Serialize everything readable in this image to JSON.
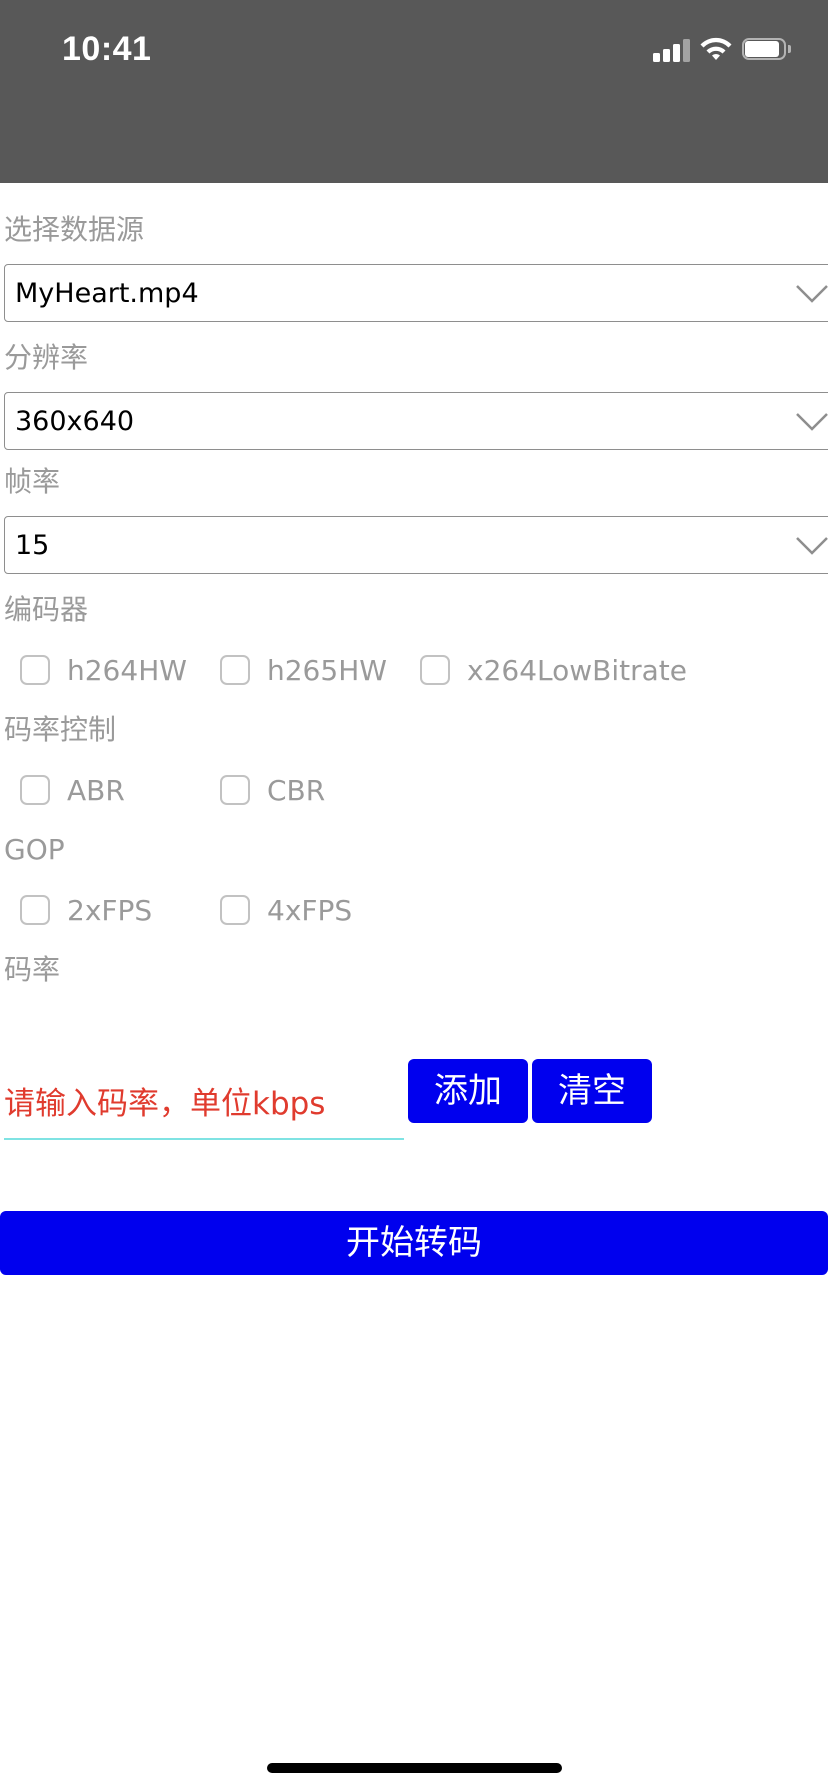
{
  "status_bar": {
    "time": "10:41",
    "background": "#585858",
    "icons": [
      "signal-icon",
      "wifi-icon",
      "battery-icon"
    ]
  },
  "form": {
    "source": {
      "label": "选择数据源",
      "value": "MyHeart.mp4"
    },
    "resolution": {
      "label": "分辨率",
      "value": "360x640"
    },
    "framerate": {
      "label": "帧率",
      "value": "15"
    },
    "encoder": {
      "label": "编码器",
      "options": [
        {
          "label": "h264HW",
          "checked": false
        },
        {
          "label": "h265HW",
          "checked": false
        },
        {
          "label": "x264LowBitrate",
          "checked": false
        }
      ]
    },
    "rate_control": {
      "label": "码率控制",
      "options": [
        {
          "label": "ABR",
          "checked": false
        },
        {
          "label": "CBR",
          "checked": false
        }
      ]
    },
    "gop": {
      "label": "GOP",
      "options": [
        {
          "label": "2xFPS",
          "checked": false
        },
        {
          "label": "4xFPS",
          "checked": false
        }
      ]
    },
    "bitrate": {
      "label": "码率",
      "placeholder": "请输入码率，单位kbps",
      "add_label": "添加",
      "clear_label": "清空"
    },
    "start_label": "开始转码"
  },
  "colors": {
    "accent_button": "#0000ee",
    "placeholder_text": "#e03b2e",
    "input_underline": "#7fe3e3",
    "label_text": "#9a9a9a"
  }
}
